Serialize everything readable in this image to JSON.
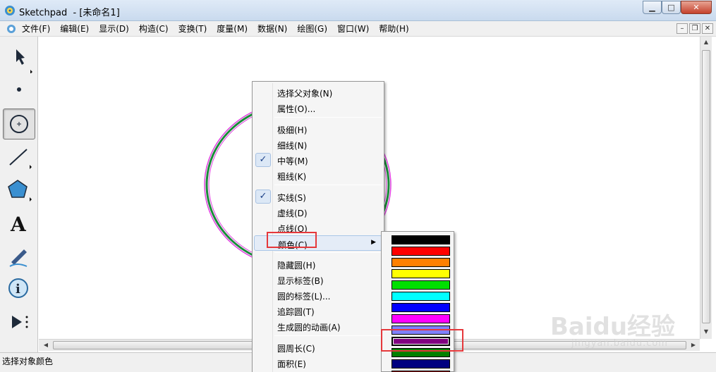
{
  "window": {
    "title": "Sketchpad  - [未命名1]",
    "buttons": [
      "minimize",
      "maximize",
      "close"
    ]
  },
  "menubar": {
    "items": [
      "文件(F)",
      "编辑(E)",
      "显示(D)",
      "构造(C)",
      "变换(T)",
      "度量(M)",
      "数据(N)",
      "绘图(G)",
      "窗口(W)",
      "帮助(H)"
    ]
  },
  "toolbox": {
    "tools": [
      "arrow-tool",
      "point-tool",
      "compass-tool",
      "straightedge-tool",
      "polygon-tool",
      "text-tool",
      "marker-tool",
      "information-tool",
      "custom-tool"
    ],
    "active": "compass-tool",
    "text_tool_glyph": "A",
    "info_tool_glyph": "i"
  },
  "context_menu": {
    "items": [
      {
        "label": "选择父对象(N)",
        "checked": false
      },
      {
        "label": "属性(O)...",
        "checked": false
      },
      {
        "separator": true
      },
      {
        "label": "极细(H)",
        "checked": false
      },
      {
        "label": "细线(N)",
        "checked": false
      },
      {
        "label": "中等(M)",
        "checked": true
      },
      {
        "label": "粗线(K)",
        "checked": false
      },
      {
        "separator": true
      },
      {
        "label": "实线(S)",
        "checked": true
      },
      {
        "label": "虚线(D)",
        "checked": false
      },
      {
        "label": "点线(O)",
        "checked": false
      },
      {
        "label": "颜色(C)",
        "checked": false,
        "submenu": true,
        "highlighted": true
      },
      {
        "separator": true
      },
      {
        "label": "隐藏圆(H)",
        "checked": false
      },
      {
        "label": "显示标签(B)",
        "checked": false
      },
      {
        "label": "圆的标签(L)...",
        "checked": false
      },
      {
        "label": "追踪圆(T)",
        "checked": false
      },
      {
        "label": "生成圆的动画(A)",
        "checked": false
      },
      {
        "separator": true
      },
      {
        "label": "圆周长(C)",
        "checked": false
      },
      {
        "label": "面积(E)",
        "checked": false
      }
    ],
    "check_glyph": "✓",
    "submenu_glyph": "▶"
  },
  "color_palette": {
    "swatches": [
      "#000000",
      "#ff0000",
      "#ff8000",
      "#ffff00",
      "#00e000",
      "#00ffff",
      "#0000ff",
      "#ff00ff",
      "#8080ff",
      "#800080",
      "#008000",
      "#000080",
      "#800000"
    ],
    "selected_index": 9
  },
  "canvas": {
    "circle_colors": {
      "outer": "#e040e0",
      "main": "#1a8a3a",
      "inner": "#e040e0"
    }
  },
  "status_bar": {
    "text": "选择对象颜色"
  },
  "highlight_color": "#e5383b",
  "watermark": {
    "big": "Baidu经验",
    "small": "jingyan.baidu.com"
  }
}
